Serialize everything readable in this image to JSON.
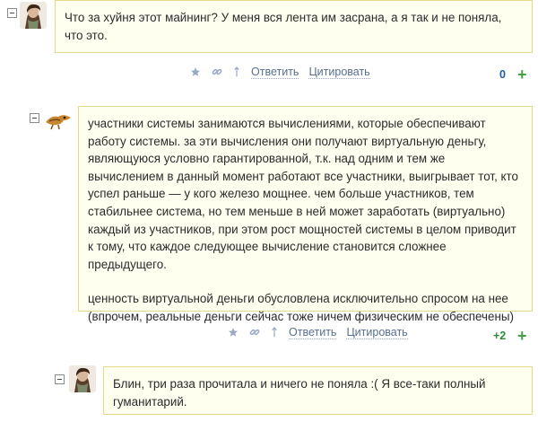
{
  "comments": [
    {
      "paragraphs": [
        "Что за хуйня этот майнинг? У меня вся лента им засрана, а я так и не поняла, что это."
      ],
      "reply_label": "Ответить",
      "quote_label": "Цитировать",
      "score": "0"
    },
    {
      "paragraphs": [
        "участники системы занимаются вычислениями, которые обеспечивают работу системы. за эти вычисления они получают виртуальную деньгу, являющуюся условно гарантированной, т.к. над одним и тем же вычислением в данный момент работают все участники, выигрывает тот, кто успел раньше — у кого железо мощнее. чем больше участников, тем стабильнее система, но тем меньше в ней может заработать (виртуально) каждый из участников, при этом рост мощностей системы в целом приводит к тому, что каждое следующее вычисление становится сложнее предыдущего.",
        "ценность виртуальной деньги обусловлена исключительно спросом на нее (впрочем, реальные деньги сейчас тоже ничем физическим не обеспечены)"
      ],
      "reply_label": "Ответить",
      "quote_label": "Цитировать",
      "score": "+2"
    },
    {
      "paragraphs": [
        "Блин, три раза прочитала и ничего не поняла :( Я все-таки полный гуманитарий."
      ]
    }
  ],
  "colors": {
    "bubble_bg": "#fffff0",
    "bubble_border": "#e6d98a",
    "link": "#596f8f",
    "score_zero": "#1e5aa8",
    "score_positive": "#2e8b3a",
    "plus": "#43a047"
  }
}
